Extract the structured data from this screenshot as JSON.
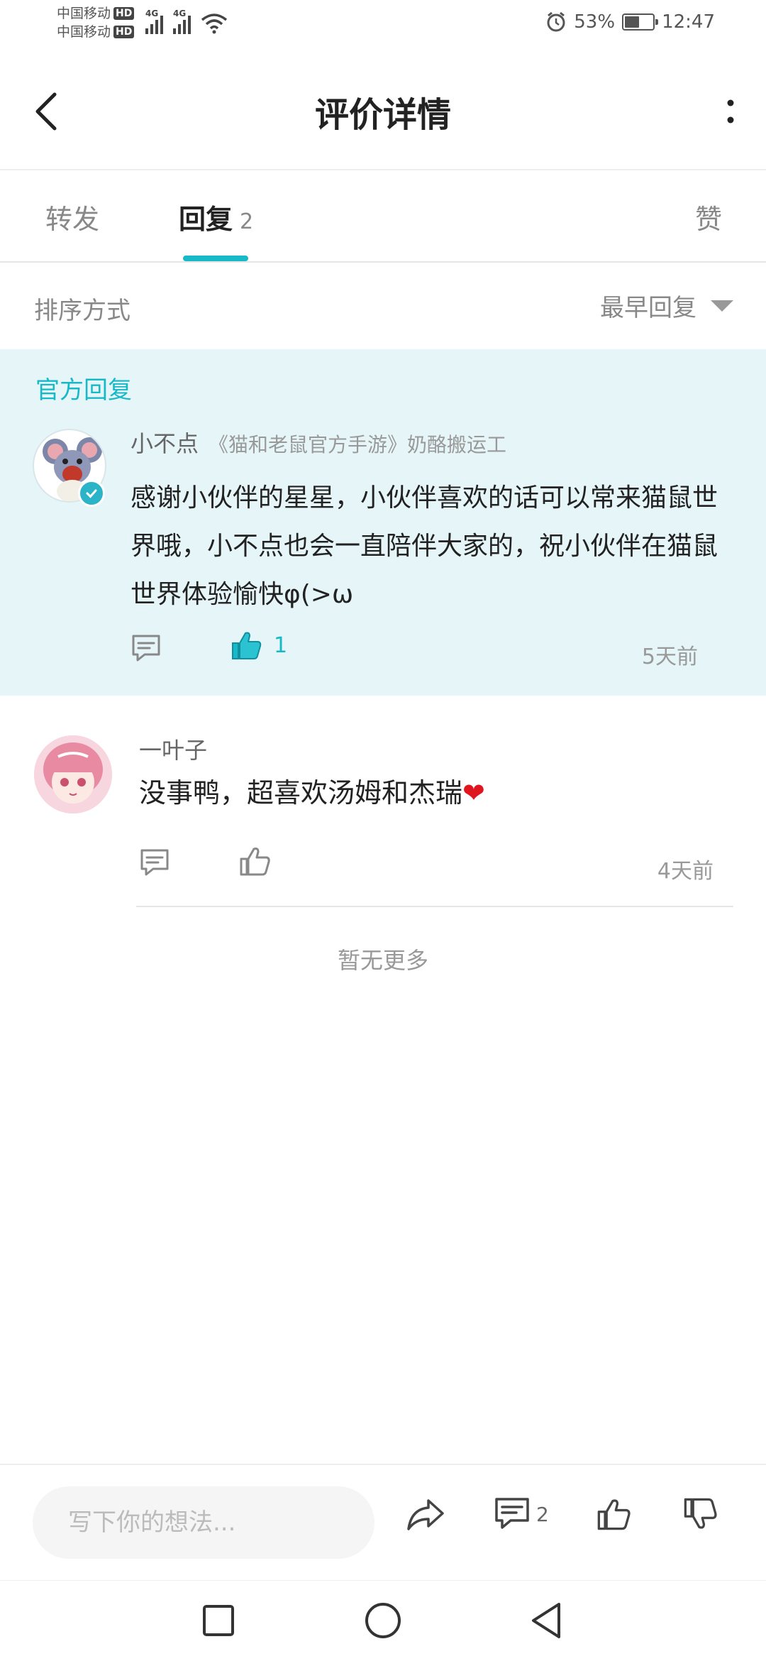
{
  "status_bar": {
    "carrier1": "中国移动",
    "carrier2": "中国移动",
    "hd": "HD",
    "network1": "4G",
    "network2": "4G",
    "battery_percent": "53%",
    "battery_level": 0.53,
    "time": "12:47"
  },
  "header": {
    "title": "评价详情"
  },
  "tabs": {
    "forward": "转发",
    "reply": "回复",
    "reply_count": "2",
    "like": "赞"
  },
  "sort": {
    "label": "排序方式",
    "selected": "最早回复"
  },
  "official_reply": {
    "section_label": "官方回复",
    "author": "小不点",
    "author_role": "《猫和老鼠官方手游》奶酪搬运工",
    "text": "感谢小伙伴的星星，小伙伴喜欢的话可以常来猫鼠世界哦，小不点也会一直陪伴大家的，祝小伙伴在猫鼠世界体验愉快φ(>ω",
    "likes": "1",
    "time": "5天前"
  },
  "reply": {
    "author": "一叶子",
    "text": "没事鸭，超喜欢汤姆和杰瑞",
    "emoji": "❤",
    "time": "4天前"
  },
  "no_more": "暂无更多",
  "bottom_bar": {
    "input_placeholder": "写下你的想法...",
    "comment_count": "2"
  },
  "colors": {
    "accent": "#17b8c8",
    "official_bg": "#e6f6f8"
  }
}
